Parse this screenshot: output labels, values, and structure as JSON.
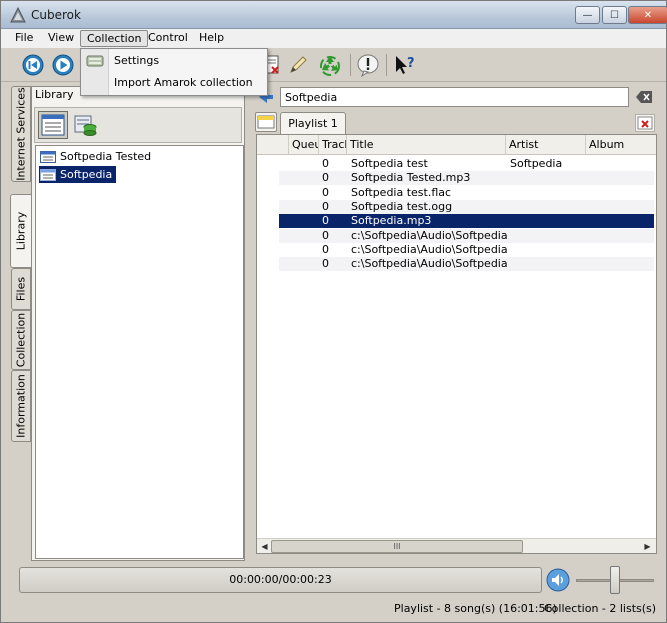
{
  "window": {
    "title": "Cuberok"
  },
  "titlebar": {
    "minimize_glyph": "—",
    "maximize_glyph": "☐",
    "close_glyph": "✕"
  },
  "menu": {
    "file": "File",
    "view": "View",
    "collection": "Collection",
    "control": "Control",
    "help": "Help"
  },
  "collection_menu": {
    "items": [
      "Settings",
      "Import Amarok collection"
    ]
  },
  "side_tabs": [
    "Internet Services",
    "Library",
    "Files",
    "Collection",
    "Information"
  ],
  "library": {
    "label": "Library",
    "items": [
      {
        "label": "Softpedia Tested",
        "selected": false
      },
      {
        "label": "Softpedia",
        "selected": true
      }
    ]
  },
  "search": {
    "value": "Softpedia"
  },
  "playlist": {
    "tab_label": "Playlist 1",
    "columns": [
      "Queue",
      "Track",
      "Title",
      "Artist",
      "Album"
    ],
    "rows": [
      {
        "track": "0",
        "title": "Softpedia test",
        "artist": "Softpedia",
        "album": ""
      },
      {
        "track": "0",
        "title": "Softpedia Tested.mp3",
        "artist": "",
        "album": ""
      },
      {
        "track": "0",
        "title": "Softpedia test.flac",
        "artist": "",
        "album": ""
      },
      {
        "track": "0",
        "title": "Softpedia test.ogg",
        "artist": "",
        "album": ""
      },
      {
        "track": "0",
        "title": "Softpedia.mp3",
        "artist": "",
        "album": "",
        "selected": true
      },
      {
        "track": "0",
        "title": "c:\\Softpedia\\Audio\\Softpedia...",
        "artist": "",
        "album": ""
      },
      {
        "track": "0",
        "title": "c:\\Softpedia\\Audio\\Softpedia...",
        "artist": "",
        "album": ""
      },
      {
        "track": "0",
        "title": "c:\\Softpedia\\Audio\\Softpedia...",
        "artist": "",
        "album": ""
      }
    ],
    "scroll_grip": "III"
  },
  "player": {
    "time": "00:00:00/00:00:23",
    "volume_fraction": 0.5
  },
  "status": {
    "playlist": "Playlist - 8 song(s) (16:01:56)",
    "collection": "Collection - 2 lists(s)"
  },
  "colors": {
    "selection": "#0a246a",
    "accent_blue": "#2a7fc0",
    "recycle_green": "#2e9a2e"
  },
  "icons": [
    "prev-icon",
    "play-icon",
    "remove-icon",
    "edit-icon",
    "recycle-icon",
    "alert-icon",
    "whats-this-icon",
    "volume-icon"
  ]
}
